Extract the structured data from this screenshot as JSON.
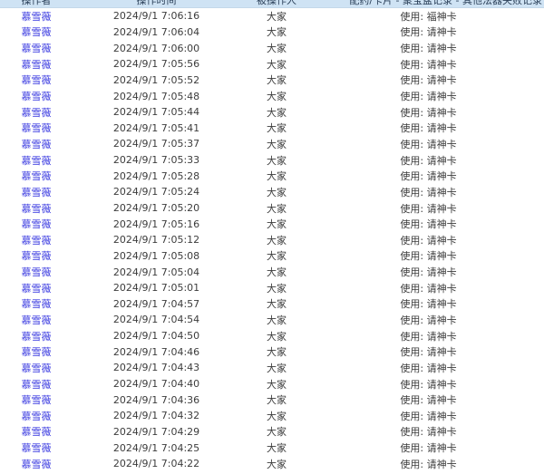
{
  "header": {
    "operator": "操作者",
    "time": "操作时间",
    "target": "被操作人",
    "action": "配药/卡片 - 聚宝盆记录 - 其他法器失败记录"
  },
  "rows": [
    {
      "operator": "慕雪薇",
      "time": "2024/9/1 7:06:16",
      "target": "大家",
      "action": "使用: 福神卡"
    },
    {
      "operator": "慕雪薇",
      "time": "2024/9/1 7:06:04",
      "target": "大家",
      "action": "使用: 请神卡"
    },
    {
      "operator": "慕雪薇",
      "time": "2024/9/1 7:06:00",
      "target": "大家",
      "action": "使用: 请神卡"
    },
    {
      "operator": "慕雪薇",
      "time": "2024/9/1 7:05:56",
      "target": "大家",
      "action": "使用: 请神卡"
    },
    {
      "operator": "慕雪薇",
      "time": "2024/9/1 7:05:52",
      "target": "大家",
      "action": "使用: 请神卡"
    },
    {
      "operator": "慕雪薇",
      "time": "2024/9/1 7:05:48",
      "target": "大家",
      "action": "使用: 请神卡"
    },
    {
      "operator": "慕雪薇",
      "time": "2024/9/1 7:05:44",
      "target": "大家",
      "action": "使用: 请神卡"
    },
    {
      "operator": "慕雪薇",
      "time": "2024/9/1 7:05:41",
      "target": "大家",
      "action": "使用: 请神卡"
    },
    {
      "operator": "慕雪薇",
      "time": "2024/9/1 7:05:37",
      "target": "大家",
      "action": "使用: 请神卡"
    },
    {
      "operator": "慕雪薇",
      "time": "2024/9/1 7:05:33",
      "target": "大家",
      "action": "使用: 请神卡"
    },
    {
      "operator": "慕雪薇",
      "time": "2024/9/1 7:05:28",
      "target": "大家",
      "action": "使用: 请神卡"
    },
    {
      "operator": "慕雪薇",
      "time": "2024/9/1 7:05:24",
      "target": "大家",
      "action": "使用: 请神卡"
    },
    {
      "operator": "慕雪薇",
      "time": "2024/9/1 7:05:20",
      "target": "大家",
      "action": "使用: 请神卡"
    },
    {
      "operator": "慕雪薇",
      "time": "2024/9/1 7:05:16",
      "target": "大家",
      "action": "使用: 请神卡"
    },
    {
      "operator": "慕雪薇",
      "time": "2024/9/1 7:05:12",
      "target": "大家",
      "action": "使用: 请神卡"
    },
    {
      "operator": "慕雪薇",
      "time": "2024/9/1 7:05:08",
      "target": "大家",
      "action": "使用: 请神卡"
    },
    {
      "operator": "慕雪薇",
      "time": "2024/9/1 7:05:04",
      "target": "大家",
      "action": "使用: 请神卡"
    },
    {
      "operator": "慕雪薇",
      "time": "2024/9/1 7:05:01",
      "target": "大家",
      "action": "使用: 请神卡"
    },
    {
      "operator": "慕雪薇",
      "time": "2024/9/1 7:04:57",
      "target": "大家",
      "action": "使用: 请神卡"
    },
    {
      "operator": "慕雪薇",
      "time": "2024/9/1 7:04:54",
      "target": "大家",
      "action": "使用: 请神卡"
    },
    {
      "operator": "慕雪薇",
      "time": "2024/9/1 7:04:50",
      "target": "大家",
      "action": "使用: 请神卡"
    },
    {
      "operator": "慕雪薇",
      "time": "2024/9/1 7:04:46",
      "target": "大家",
      "action": "使用: 请神卡"
    },
    {
      "operator": "慕雪薇",
      "time": "2024/9/1 7:04:43",
      "target": "大家",
      "action": "使用: 请神卡"
    },
    {
      "operator": "慕雪薇",
      "time": "2024/9/1 7:04:40",
      "target": "大家",
      "action": "使用: 请神卡"
    },
    {
      "operator": "慕雪薇",
      "time": "2024/9/1 7:04:36",
      "target": "大家",
      "action": "使用: 请神卡"
    },
    {
      "operator": "慕雪薇",
      "time": "2024/9/1 7:04:32",
      "target": "大家",
      "action": "使用: 请神卡"
    },
    {
      "operator": "慕雪薇",
      "time": "2024/9/1 7:04:29",
      "target": "大家",
      "action": "使用: 请神卡"
    },
    {
      "operator": "慕雪薇",
      "time": "2024/9/1 7:04:25",
      "target": "大家",
      "action": "使用: 请神卡"
    },
    {
      "operator": "慕雪薇",
      "time": "2024/9/1 7:04:22",
      "target": "大家",
      "action": "使用: 请神卡"
    }
  ]
}
